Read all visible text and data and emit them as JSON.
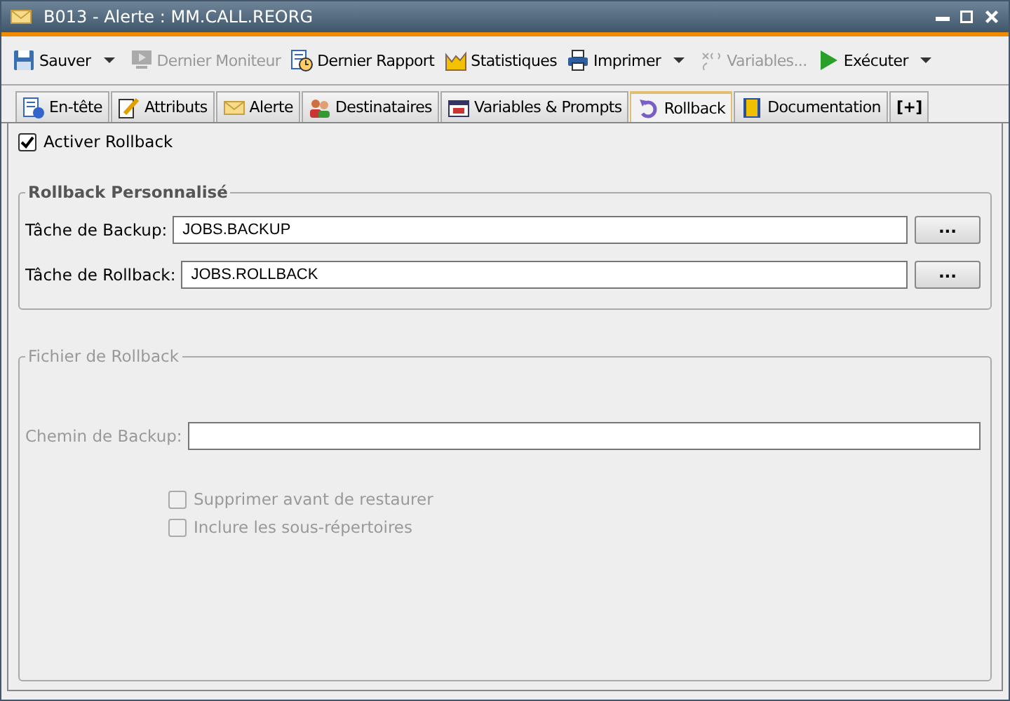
{
  "window": {
    "title": "B013 - Alerte : MM.CALL.REORG"
  },
  "toolbar": [
    {
      "label": "Sauver",
      "disabled": false,
      "dropdown": true
    },
    {
      "label": "Dernier Moniteur",
      "disabled": true,
      "dropdown": false
    },
    {
      "label": "Dernier Rapport",
      "disabled": false,
      "dropdown": false
    },
    {
      "label": "Statistiques",
      "disabled": false,
      "dropdown": false
    },
    {
      "label": "Imprimer",
      "disabled": false,
      "dropdown": true
    },
    {
      "label": "Variables...",
      "disabled": true,
      "dropdown": false
    },
    {
      "label": "Exécuter",
      "disabled": false,
      "dropdown": true
    }
  ],
  "tabs": [
    {
      "label": "En-tête",
      "selected": false
    },
    {
      "label": "Attributs",
      "selected": false
    },
    {
      "label": "Alerte",
      "selected": false
    },
    {
      "label": "Destinataires",
      "selected": false
    },
    {
      "label": "Variables & Prompts",
      "selected": false
    },
    {
      "label": "Rollback",
      "selected": true
    },
    {
      "label": "Documentation",
      "selected": false
    },
    {
      "label": "[+]",
      "selected": false
    }
  ],
  "enable_checkbox": {
    "label": "Activer Rollback",
    "checked": true
  },
  "groups": [
    {
      "title": "Rollback Personnalisé",
      "disabled": false,
      "fields": [
        {
          "label": "Tâche de Backup:",
          "value": "JOBS.BACKUP",
          "button": "..."
        },
        {
          "label": "Tâche de Rollback:",
          "value": "JOBS.ROLLBACK",
          "button": "..."
        }
      ]
    },
    {
      "title": "Fichier de Rollback",
      "disabled": true,
      "fields": [
        {
          "label": "Chemin de Backup:"
        }
      ],
      "checkboxes": [
        {
          "label": "Supprimer avant de restaurer",
          "checked": false
        },
        {
          "label": "Inclure les sous-répertoires",
          "checked": false
        }
      ]
    }
  ]
}
